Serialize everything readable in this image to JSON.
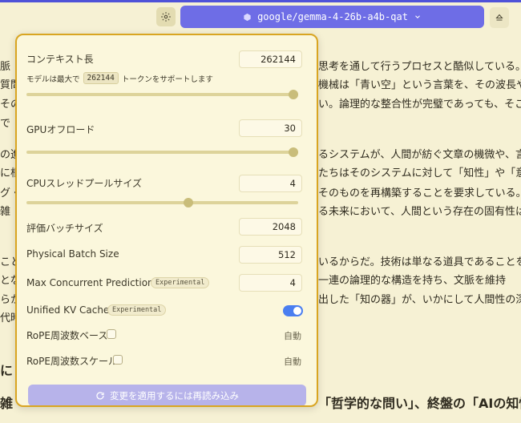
{
  "topbar": {
    "model_name": "google/gemma-4-26b-a4b-qat",
    "icons": [
      "gear-icon",
      "cube-icon",
      "chevron-down-icon",
      "eject-icon"
    ]
  },
  "article": {
    "lines": [
      {
        "left": "",
        "right": "思考を通して行うプロセスと酷似している。し",
        "leftFrag": "脈"
      },
      {
        "left": "",
        "right": "機械は「青い空」という言葉を、その波長や視",
        "leftFrag": "質問"
      },
      {
        "left": "",
        "right": "い。論理的な整合性が完璧であっても、そこ",
        "leftFrag": "その"
      },
      {
        "left": "",
        "right": "",
        "leftFrag": "で"
      },
      {
        "left": "",
        "right": "るシステムが、人間が紡ぐ文章の機微や、言",
        "leftFrag": "の進"
      },
      {
        "left": "",
        "right": "たちはそのシステムに対して「知性」や「意識」",
        "leftFrag": "に根"
      },
      {
        "left": "",
        "right": "そのものを再構築することを要求している。議",
        "leftFrag": "グ・"
      },
      {
        "left": "",
        "right": "る未来において、人間という存在の固有性は",
        "leftFrag": "雑"
      },
      {
        "left": "",
        "right": "いるからだ。技術は単なる道具であることを超",
        "leftFrag": "こと"
      },
      {
        "left": "",
        "right": "一連の論理的な構造を持ち、文脈を維持",
        "leftFrag": "とな"
      },
      {
        "left": "",
        "right": "出した「知の器」が、いかにして人間性の深淵",
        "leftFrag": "らか"
      },
      {
        "left": "",
        "right": "",
        "leftFrag": "代時"
      },
      {
        "left": "",
        "right": "",
        "leftFrag": "に"
      },
      {
        "left": "",
        "right": "「哲学的な問い」、終盤の「AIの知性」へと、",
        "leftFrag": "雑"
      }
    ]
  },
  "panel": {
    "context_length": {
      "label": "コンテキスト長",
      "value": "262144",
      "hint_prefix": "モデルは最大で",
      "hint_value": "262144",
      "hint_suffix": "トークンをサポートします",
      "slider_fraction": 1.0
    },
    "gpu_offload": {
      "label": "GPUオフロード",
      "value": "30",
      "slider_fraction": 1.0
    },
    "cpu_threads": {
      "label": "CPUスレッドプールサイズ",
      "value": "4",
      "slider_fraction": 0.6
    },
    "eval_batch": {
      "label": "評価バッチサイズ",
      "value": "2048"
    },
    "physical_batch": {
      "label": "Physical Batch Size",
      "value": "512"
    },
    "max_concurrent": {
      "label": "Max Concurrent Predictions",
      "badge": "Experimental",
      "value": "4"
    },
    "unified_kv": {
      "label": "Unified KV Cache",
      "badge": "Experimental",
      "enabled": true
    },
    "rope_base": {
      "label": "RoPE周波数ベース",
      "auto": "自動"
    },
    "rope_scale": {
      "label": "RoPE周波数スケール",
      "auto": "自動"
    },
    "reload_button": "変更を適用するには再読み込み",
    "colors": {
      "accent": "#6e6de6",
      "border": "#d9a521",
      "toggle": "#4a7ef0"
    }
  }
}
